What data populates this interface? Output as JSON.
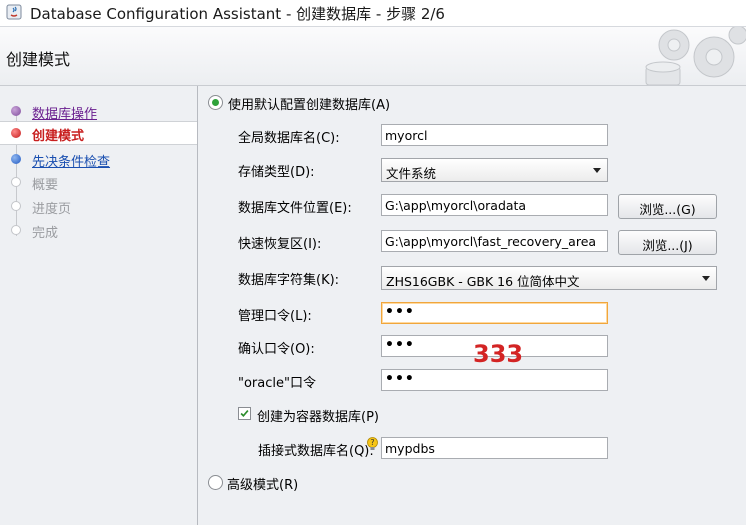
{
  "window": {
    "title": "Database Configuration Assistant - 创建数据库 - 步骤 2/6"
  },
  "header": {
    "page_title": "创建模式"
  },
  "nav": {
    "steps": [
      {
        "label": "数据库操作",
        "state": "done"
      },
      {
        "label": "创建模式",
        "state": "current"
      },
      {
        "label": "先决条件检查",
        "state": "next"
      },
      {
        "label": "概要",
        "state": "pending"
      },
      {
        "label": "进度页",
        "state": "pending"
      },
      {
        "label": "完成",
        "state": "pending"
      }
    ]
  },
  "form": {
    "default_mode": {
      "label": "使用默认配置创建数据库(A)",
      "selected": true
    },
    "global_db_name": {
      "label": "全局数据库名(C):",
      "value": "myorcl"
    },
    "storage_type": {
      "label": "存储类型(D):",
      "value": "文件系统"
    },
    "db_file_location": {
      "label": "数据库文件位置(E):",
      "value": "G:\\app\\myorcl\\oradata",
      "browse_label": "浏览...(G)"
    },
    "fast_recovery_area": {
      "label": "快速恢复区(I):",
      "value": "G:\\app\\myorcl\\fast_recovery_area",
      "browse_label": "浏览...(J)"
    },
    "charset": {
      "label": "数据库字符集(K):",
      "value": "ZHS16GBK - GBK 16 位简体中文"
    },
    "admin_password": {
      "label": "管理口令(L):",
      "value": "•••"
    },
    "confirm_password": {
      "label": "确认口令(O):",
      "value": "•••"
    },
    "oracle_password": {
      "label": "\"oracle\"口令",
      "value": "•••"
    },
    "container_db": {
      "label": "创建为容器数据库(P)",
      "checked": true
    },
    "pluggable_db_name": {
      "label": "插接式数据库名(Q):",
      "value": "mypdbs"
    },
    "advanced_mode": {
      "label": "高级模式(R)",
      "selected": false
    }
  },
  "annotation": {
    "text": "333",
    "color": "#d32424"
  },
  "colors": {
    "radio_selected": "#2fa23a",
    "checkbox_check": "#2c8d2c",
    "focus_border": "#f0a63c"
  }
}
